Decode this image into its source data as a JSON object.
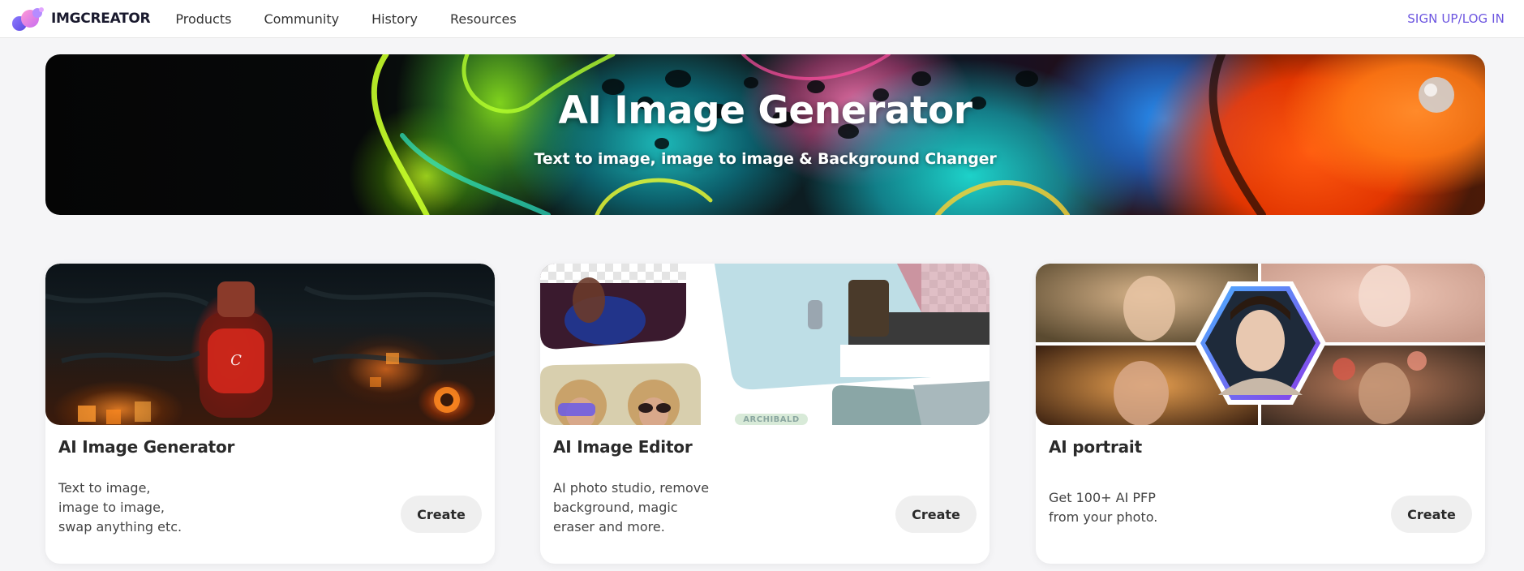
{
  "nav": {
    "logo_text": "IMGCREATOR",
    "links": [
      "Products",
      "Community",
      "History",
      "Resources"
    ],
    "auth": "SIGN UP/LOG IN"
  },
  "hero": {
    "title": "AI Image Generator",
    "subtitle": "Text to image, image to image & Background Changer"
  },
  "cards": [
    {
      "title": "AI Image Generator",
      "desc_lines": [
        "Text to image,",
        "image to image,",
        "swap anything etc."
      ],
      "button": "Create"
    },
    {
      "title": "AI Image Editor",
      "desc_lines": [
        "AI photo studio, remove",
        "background, magic",
        "eraser and more."
      ],
      "button": "Create",
      "image_label": "ARCHIBALD"
    },
    {
      "title": "AI portrait",
      "desc_lines": [
        "Get 100+ AI PFP",
        "from your photo."
      ],
      "button": "Create"
    }
  ],
  "colors": {
    "accent": "#6c55e0",
    "button_bg": "#efefef",
    "page_bg": "#f5f5f7"
  }
}
